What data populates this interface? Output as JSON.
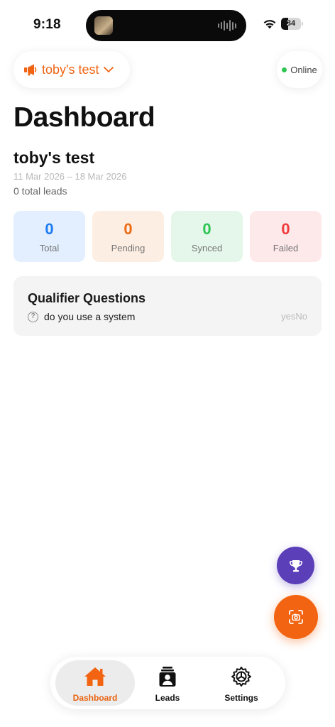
{
  "status_bar": {
    "time": "9:18",
    "battery": "34"
  },
  "header": {
    "campaign_label": "toby's test",
    "connection_status": "Online"
  },
  "page_title": "Dashboard",
  "campaign": {
    "name": "toby's test",
    "date_range": "11 Mar 2026 – 18 Mar 2026",
    "total_leads_text": "0 total leads"
  },
  "stats": [
    {
      "value": "0",
      "label": "Total",
      "bg": "#e3efff",
      "color": "#1e7bf2"
    },
    {
      "value": "0",
      "label": "Pending",
      "bg": "#fdeee3",
      "color": "#ee6a14"
    },
    {
      "value": "0",
      "label": "Synced",
      "bg": "#e5f7ea",
      "color": "#2ec552"
    },
    {
      "value": "0",
      "label": "Failed",
      "bg": "#fde8ea",
      "color": "#ef3b3b"
    }
  ],
  "qualifier": {
    "title": "Qualifier Questions",
    "questions": [
      {
        "text": "do you use a system",
        "type": "yesNo"
      }
    ]
  },
  "fabs": {
    "top_icon": "trophy-icon",
    "bottom_icon": "camera-scan-icon"
  },
  "tabs": [
    {
      "label": "Dashboard",
      "icon": "home-icon",
      "active": true
    },
    {
      "label": "Leads",
      "icon": "contacts-icon",
      "active": false
    },
    {
      "label": "Settings",
      "icon": "gear-icon",
      "active": false
    }
  ],
  "colors": {
    "accent": "#f26411",
    "trophy": "#5a3fb8",
    "online": "#2ec552"
  }
}
